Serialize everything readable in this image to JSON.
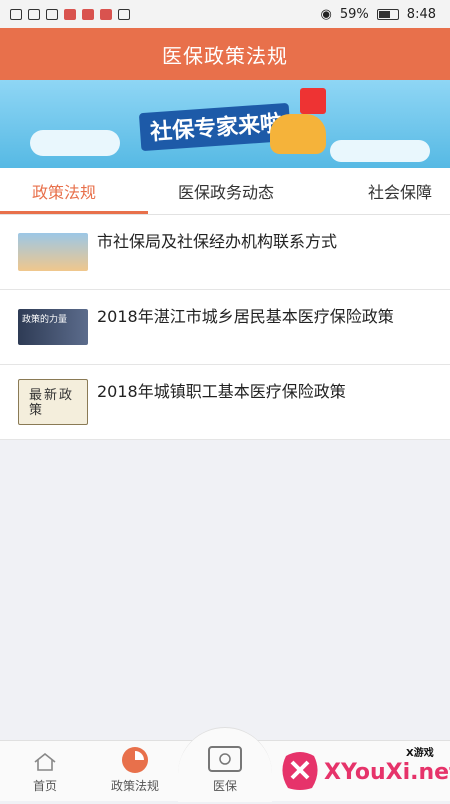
{
  "status": {
    "battery": "59%",
    "time": "8:48"
  },
  "header": {
    "title": "医保政策法规"
  },
  "banner": {
    "text": "社保专家来啦"
  },
  "tabs": [
    {
      "label": "政策法规",
      "active": true
    },
    {
      "label": "医保政务动态",
      "active": false
    },
    {
      "label": "社会保障",
      "active": false
    }
  ],
  "list": [
    {
      "title": "市社保局及社保经办机构联系方式"
    },
    {
      "title": "2018年湛江市城乡居民基本医疗保险政策"
    },
    {
      "title": "2018年城镇职工基本医疗保险政策"
    }
  ],
  "thumbs": {
    "t2": "政策的力量",
    "t3": "最新政策"
  },
  "nav": [
    {
      "label": "首页"
    },
    {
      "label": "政策法规"
    },
    {
      "label": "医保"
    }
  ],
  "watermark": {
    "text": "XYouXi.net",
    "sub": "X游戏"
  },
  "colors": {
    "accent": "#e8704b",
    "link_active": "#e8704b"
  }
}
